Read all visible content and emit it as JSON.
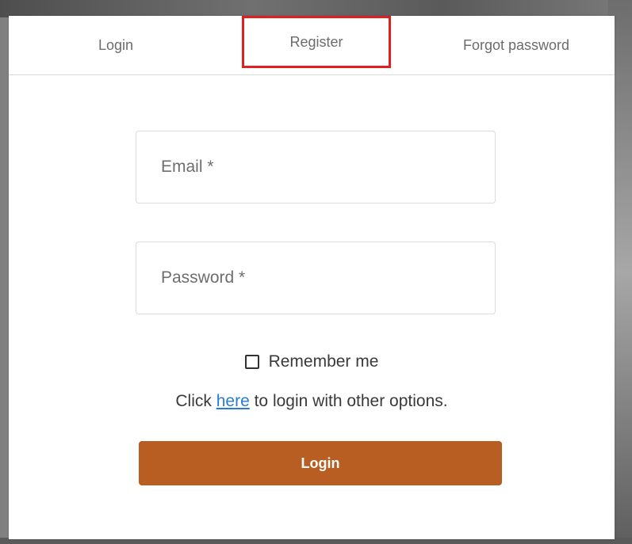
{
  "tabs": {
    "login": "Login",
    "register": "Register",
    "forgot": "Forgot password"
  },
  "form": {
    "email_placeholder": "Email *",
    "password_placeholder": "Password *",
    "remember_label": "Remember me",
    "other_prefix": "Click ",
    "other_link": "here",
    "other_suffix": " to login with other options.",
    "login_button": "Login"
  },
  "colors": {
    "accent": "#b85e22",
    "highlight": "#e01f1f",
    "link": "#2a7bd6"
  }
}
